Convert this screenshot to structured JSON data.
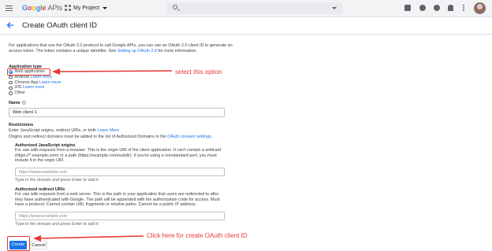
{
  "topbar": {
    "logo": [
      "G",
      "o",
      "o",
      "g",
      "l",
      "e"
    ],
    "logo_suffix": "APIs",
    "project": "My Project",
    "icons": [
      "menu-icon",
      "search-icon",
      "gift-icon",
      "terminal-icon",
      "help-icon",
      "notifications-icon",
      "more-vert-icon",
      "avatar"
    ]
  },
  "header": {
    "title": "Create OAuth client ID"
  },
  "intro": {
    "text": "For applications that use the OAuth 2.0 protocol to call Google APIs, you can use an OAuth 2.0 client ID to generate an access token. The token contains a unique identifier. See ",
    "link": "Setting up OAuth 2.0",
    "after": " for more information."
  },
  "app_type": {
    "label": "Application type",
    "options": [
      {
        "label": "Web application",
        "checked": true,
        "learn": ""
      },
      {
        "label": "Android",
        "checked": false,
        "learn": "Learn more"
      },
      {
        "label": "Chrome App",
        "checked": false,
        "learn": "Learn more"
      },
      {
        "label": "iOS",
        "checked": false,
        "learn": "Learn more"
      },
      {
        "label": "Other",
        "checked": false,
        "learn": ""
      }
    ]
  },
  "name": {
    "label": "Name",
    "value": "Web client 1"
  },
  "restrictions": {
    "label": "Restrictions",
    "desc": "Enter JavaScript origins, redirect URIs, or both ",
    "desc_link": "Learn More",
    "desc2": "Origins and redirect domains must be added to the list of Authorized Domains in the ",
    "desc2_link": "OAuth consent settings",
    "desc2_after": "."
  },
  "js_origins": {
    "label": "Authorized JavaScript origins",
    "desc": "For use with requests from a browser. This is the origin URI of the client application. It can't contain a wildcard (https://*.example.com) or a path (https://example.com/subdir). If you're using a nonstandard port, you must include it in the origin URI.",
    "placeholder": "https://www.example.com",
    "hint": "Type in the domain and press Enter to add it"
  },
  "redirect_uris": {
    "label": "Authorized redirect URIs",
    "desc": "For use with requests from a web server. This is the path in your application that users are redirected to after they have authenticated with Google. The path will be appended with the authorization code for access. Must have a protocol. Cannot contain URL fragments or relative paths. Cannot be a public IP address.",
    "placeholder": "https://www.example.com",
    "hint": "Type in the domain and press Enter to add it"
  },
  "buttons": {
    "create": "Create",
    "cancel": "Cancel"
  },
  "annotations": {
    "select": "select this option",
    "create": "Click here for create OAuth client ID",
    "color": "#e53935"
  },
  "colors": {
    "accent": "#1a73e8",
    "annotation": "#e53935"
  }
}
